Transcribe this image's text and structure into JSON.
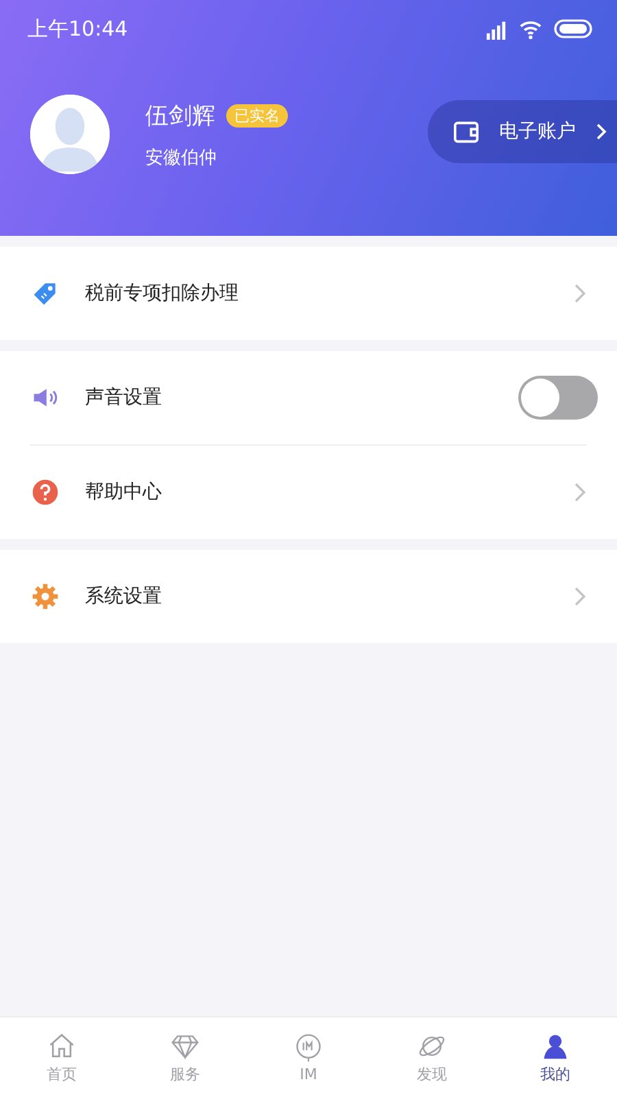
{
  "status_bar": {
    "time": "上午10:44"
  },
  "profile": {
    "name": "伍剑辉",
    "badge": "已实名",
    "company": "安徽伯仲"
  },
  "wallet_button": {
    "label": "电子账户"
  },
  "groups": [
    {
      "items": [
        {
          "kind": "link",
          "label": "税前专项扣除办理"
        }
      ]
    },
    {
      "items": [
        {
          "kind": "toggle",
          "label": "声音设置",
          "on": false
        },
        {
          "kind": "link",
          "label": "帮助中心"
        }
      ]
    },
    {
      "items": [
        {
          "kind": "link",
          "label": "系统设置"
        }
      ]
    }
  ],
  "tabs": [
    {
      "label": "首页",
      "selected": false
    },
    {
      "label": "服务",
      "selected": false
    },
    {
      "label": "IM",
      "selected": false
    },
    {
      "label": "发现",
      "selected": false
    },
    {
      "label": "我的",
      "selected": true
    }
  ]
}
